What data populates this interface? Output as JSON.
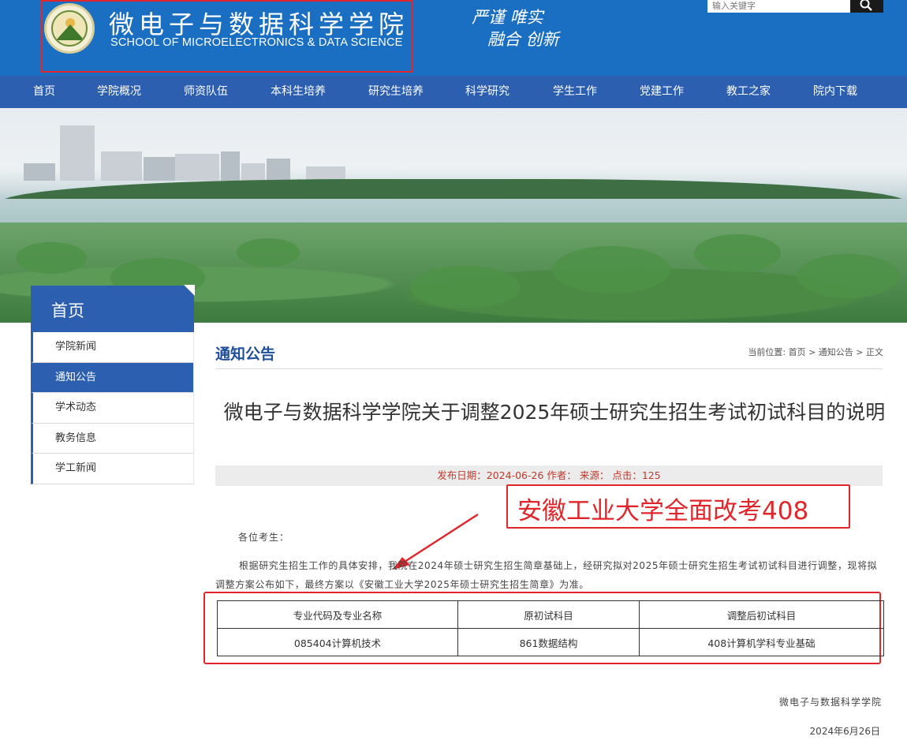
{
  "header": {
    "school_cn": "微电子与数据科学学院",
    "school_en": "SCHOOL OF MICROELECTRONICS & DATA SCIENCE",
    "motto_line1": "严谨  唯实",
    "motto_line2": "融合  创新",
    "search_placeholder": "输入关键字",
    "brand_color": "#1a6fc2",
    "highlight_color": "#e0262b"
  },
  "nav": {
    "items": [
      "首页",
      "学院概况",
      "师资队伍",
      "本科生培养",
      "研究生培养",
      "科学研究",
      "学生工作",
      "党建工作",
      "教工之家",
      "院内下载"
    ],
    "color": "#2c5fb0"
  },
  "sidebar": {
    "title": "首页",
    "items": [
      {
        "label": "学院新闻",
        "active": false
      },
      {
        "label": "通知公告",
        "active": true
      },
      {
        "label": "学术动态",
        "active": false
      },
      {
        "label": "教务信息",
        "active": false
      },
      {
        "label": "学工新闻",
        "active": false
      }
    ]
  },
  "main": {
    "section_title": "通知公告",
    "breadcrumb": {
      "prefix": "当前位置:",
      "home": "首页",
      "sep": ">",
      "section": "通知公告",
      "current": "正文"
    },
    "article_title": "微电子与数据科学学院关于调整2025年硕士研究生招生考试初试科目的说明",
    "meta": "发布日期：2024-06-26 作者： 来源： 点击：125",
    "annotation": "安徽工业大学全面改考408",
    "greeting": "各位考生：",
    "paragraph": "根据研究生招生工作的具体安排，我院在2024年硕士研究生招生简章基础上，经研究拟对2025年硕士研究生招生考试初试科目进行调整，现将拟调整方案公布如下，最终方案以《安徽工业大学2025年硕士研究生招生简章》为准。",
    "table": {
      "headers": [
        "专业代码及专业名称",
        "原初试科目",
        "调整后初试科目"
      ],
      "rows": [
        [
          "085404计算机技术",
          "861数据结构",
          "408计算机学科专业基础"
        ]
      ]
    },
    "signature": "微电子与数据科学学院",
    "date": "2024年6月26日"
  }
}
